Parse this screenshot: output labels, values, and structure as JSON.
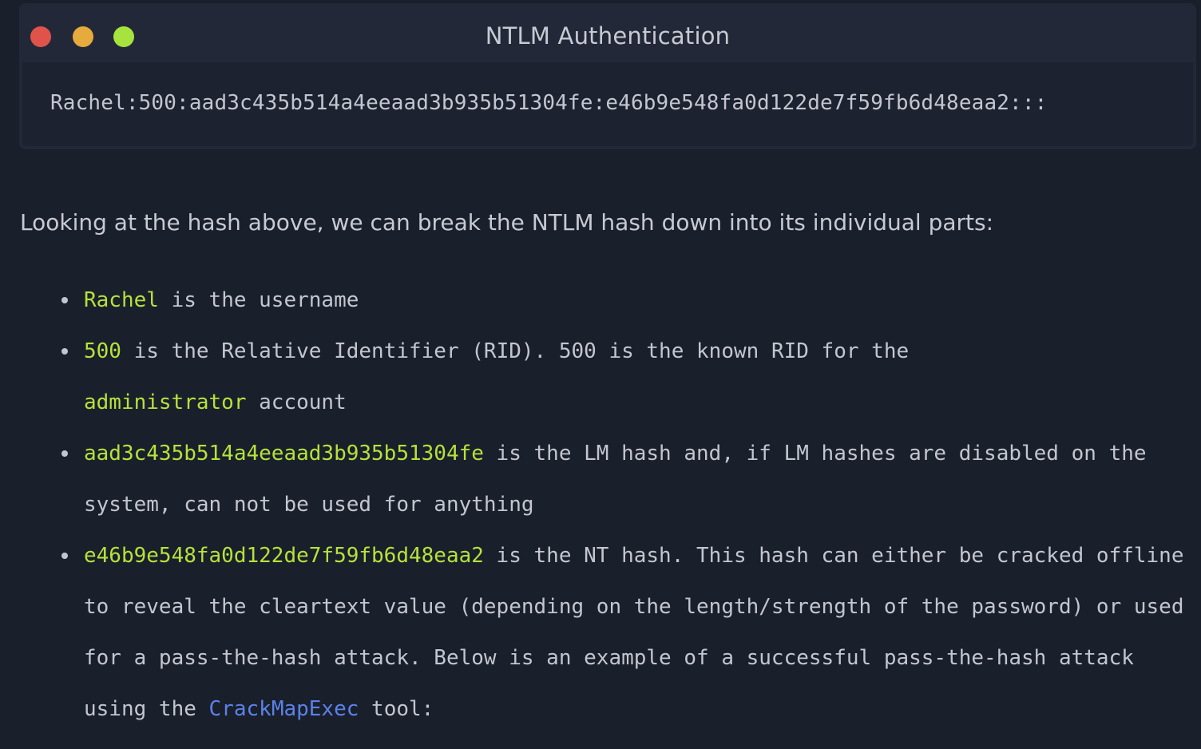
{
  "window": {
    "title": "NTLM Authentication",
    "code": "Rachel:500:aad3c435b514a4eeaad3b935b51304fe:e46b9e548fa0d122de7f59fb6d48eaa2:::"
  },
  "intro": "Looking at the hash above, we can break the NTLM hash down into its individual parts:",
  "items": [
    {
      "term": "Rachel",
      "text": " is the username"
    },
    {
      "term": "500",
      "text": " is the Relative Identifier (RID). 500 is the known RID for the",
      "term2": "administrator",
      "text2": " account"
    },
    {
      "term": "aad3c435b514a4eeaad3b935b51304fe",
      "text": " is the LM hash and, if LM hashes are disabled on the system, can not be used for anything"
    },
    {
      "term": "e46b9e548fa0d122de7f59fb6d48eaa2",
      "text": " is the NT hash. This hash can either be cracked offline to reveal the cleartext value (depending on the length/strength of the password) or used for a pass-the-hash attack. Below is an example of a successful pass-the-hash attack using the ",
      "link": "CrackMapExec",
      "text_after_link": " tool:"
    }
  ],
  "colors": {
    "background": "#1a1f2c",
    "window": "#232838",
    "highlight": "#b5e33a",
    "link": "#5b82e8",
    "close": "#e0534a",
    "minimize": "#e7aa3c",
    "maximize": "#a7e33e"
  }
}
